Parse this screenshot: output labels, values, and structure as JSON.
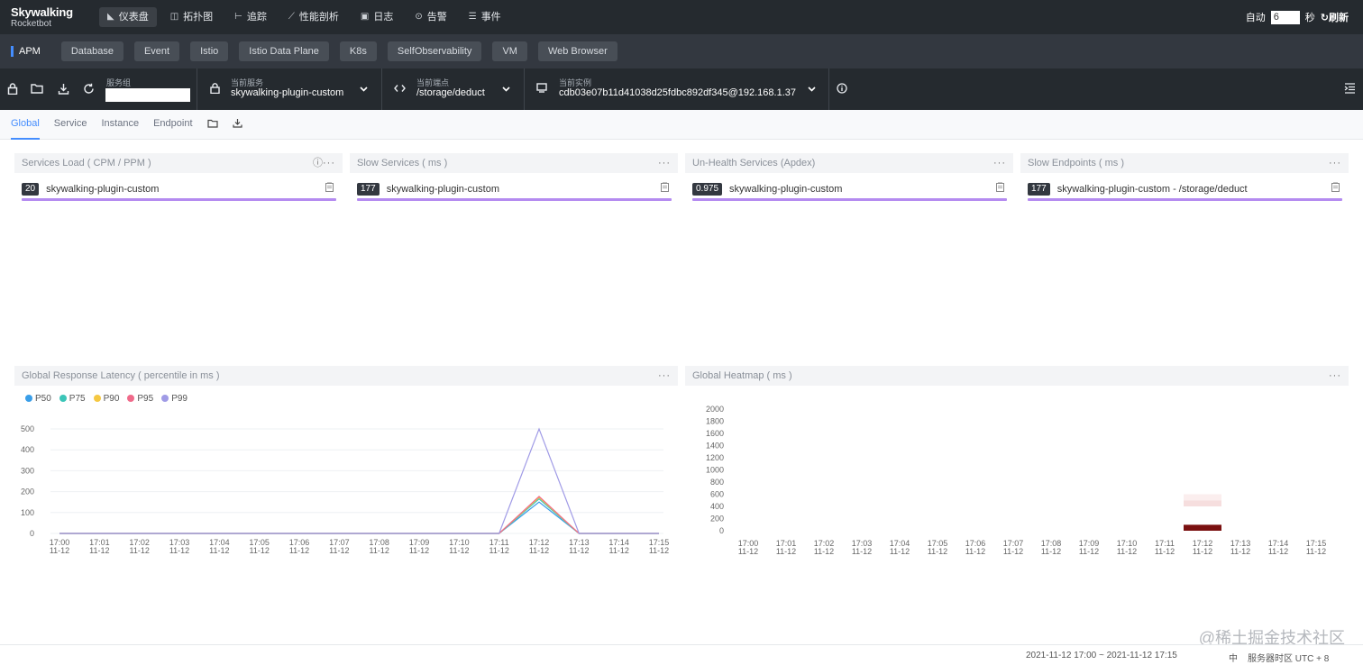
{
  "app": {
    "logo_title": "Skywalking",
    "logo_subtitle": "Rocketbot"
  },
  "nav": [
    {
      "label": "仪表盘",
      "icon": "dashboard-icon",
      "glyph": "◣"
    },
    {
      "label": "拓扑图",
      "icon": "topology-icon",
      "glyph": "◫"
    },
    {
      "label": "追踪",
      "icon": "trace-icon",
      "glyph": "⊢"
    },
    {
      "label": "性能剖析",
      "icon": "profile-icon",
      "glyph": "⟋"
    },
    {
      "label": "日志",
      "icon": "log-icon",
      "glyph": "▣"
    },
    {
      "label": "告警",
      "icon": "alarm-icon",
      "glyph": "⊙"
    },
    {
      "label": "事件",
      "icon": "event-icon",
      "glyph": "☰"
    }
  ],
  "auto_refresh": {
    "label": "自动",
    "interval": "6",
    "unit": "秒",
    "refresh_label": "刷新"
  },
  "templates": [
    "APM",
    "Database",
    "Event",
    "Istio",
    "Istio Data Plane",
    "K8s",
    "SelfObservability",
    "VM",
    "Web Browser"
  ],
  "selectors": {
    "group": {
      "label": "服务组",
      "value": ""
    },
    "service": {
      "label": "当前服务",
      "value": "skywalking-plugin-custom"
    },
    "endpoint": {
      "label": "当前端点",
      "value": "/storage/deduct"
    },
    "instance": {
      "label": "当前实例",
      "value": "cdb03e07b11d41038d25fdbc892df345@192.168.1.37"
    }
  },
  "tabs": [
    "Global",
    "Service",
    "Instance",
    "Endpoint"
  ],
  "panels": [
    {
      "title": "Services Load ( CPM / PPM )",
      "badge": "20",
      "name": "skywalking-plugin-custom"
    },
    {
      "title": "Slow Services ( ms )",
      "badge": "177",
      "name": "skywalking-plugin-custom"
    },
    {
      "title": "Un-Health Services (Apdex)",
      "badge": "0.975",
      "name": "skywalking-plugin-custom"
    },
    {
      "title": "Slow Endpoints ( ms )",
      "badge": "177",
      "name": "skywalking-plugin-custom - /storage/deduct"
    }
  ],
  "more_label": "···",
  "chart_data": [
    {
      "type": "line",
      "title": "Global Response Latency ( percentile in ms )",
      "x": [
        "17:00\n11-12",
        "17:01\n11-12",
        "17:02\n11-12",
        "17:03\n11-12",
        "17:04\n11-12",
        "17:05\n11-12",
        "17:06\n11-12",
        "17:07\n11-12",
        "17:08\n11-12",
        "17:09\n11-12",
        "17:10\n11-12",
        "17:11\n11-12",
        "17:12\n11-12",
        "17:13\n11-12",
        "17:14\n11-12",
        "17:15\n11-12"
      ],
      "yticks": [
        0,
        100,
        200,
        300,
        400,
        500
      ],
      "ylim": [
        0,
        500
      ],
      "series": [
        {
          "name": "P50",
          "color": "#3a9ee8",
          "values": [
            0,
            0,
            0,
            0,
            0,
            0,
            0,
            0,
            0,
            0,
            0,
            0,
            150,
            0,
            0,
            0
          ]
        },
        {
          "name": "P75",
          "color": "#3cc5b8",
          "values": [
            0,
            0,
            0,
            0,
            0,
            0,
            0,
            0,
            0,
            0,
            0,
            0,
            165,
            0,
            0,
            0
          ]
        },
        {
          "name": "P90",
          "color": "#f5c842",
          "values": [
            0,
            0,
            0,
            0,
            0,
            0,
            0,
            0,
            0,
            0,
            0,
            0,
            172,
            0,
            0,
            0
          ]
        },
        {
          "name": "P95",
          "color": "#f06a8a",
          "values": [
            0,
            0,
            0,
            0,
            0,
            0,
            0,
            0,
            0,
            0,
            0,
            0,
            177,
            0,
            0,
            0
          ]
        },
        {
          "name": "P99",
          "color": "#a09be6",
          "values": [
            0,
            0,
            0,
            0,
            0,
            0,
            0,
            0,
            0,
            0,
            0,
            0,
            500,
            0,
            0,
            0
          ]
        }
      ],
      "grid": true,
      "legend": "top-left"
    },
    {
      "type": "heatmap",
      "title": "Global Heatmap ( ms )",
      "x": [
        "17:00\n11-12",
        "17:01\n11-12",
        "17:02\n11-12",
        "17:03\n11-12",
        "17:04\n11-12",
        "17:05\n11-12",
        "17:06\n11-12",
        "17:07\n11-12",
        "17:08\n11-12",
        "17:09\n11-12",
        "17:10\n11-12",
        "17:11\n11-12",
        "17:12\n11-12",
        "17:13\n11-12",
        "17:14\n11-12",
        "17:15\n11-12"
      ],
      "yticks": [
        0,
        200,
        400,
        600,
        800,
        1000,
        1200,
        1400,
        1600,
        1800,
        2000
      ],
      "ylim": [
        0,
        2000
      ],
      "cells": [
        {
          "x": "17:12",
          "y_from": 0,
          "y_to": 100,
          "color": "#7a1010"
        },
        {
          "x": "17:12",
          "y_from": 100,
          "y_to": 200,
          "color": "#ffffff"
        },
        {
          "x": "17:12",
          "y_from": 400,
          "y_to": 500,
          "color": "#f6dede"
        },
        {
          "x": "17:12",
          "y_from": 500,
          "y_to": 600,
          "color": "#fbeeee"
        }
      ]
    }
  ],
  "footer": {
    "range": "2021-11-12 17:00 ~ 2021-11-12 17:15",
    "lang": "中",
    "timezone": "服务器时区 UTC + 8"
  },
  "watermark": "@稀土掘金技术社区"
}
